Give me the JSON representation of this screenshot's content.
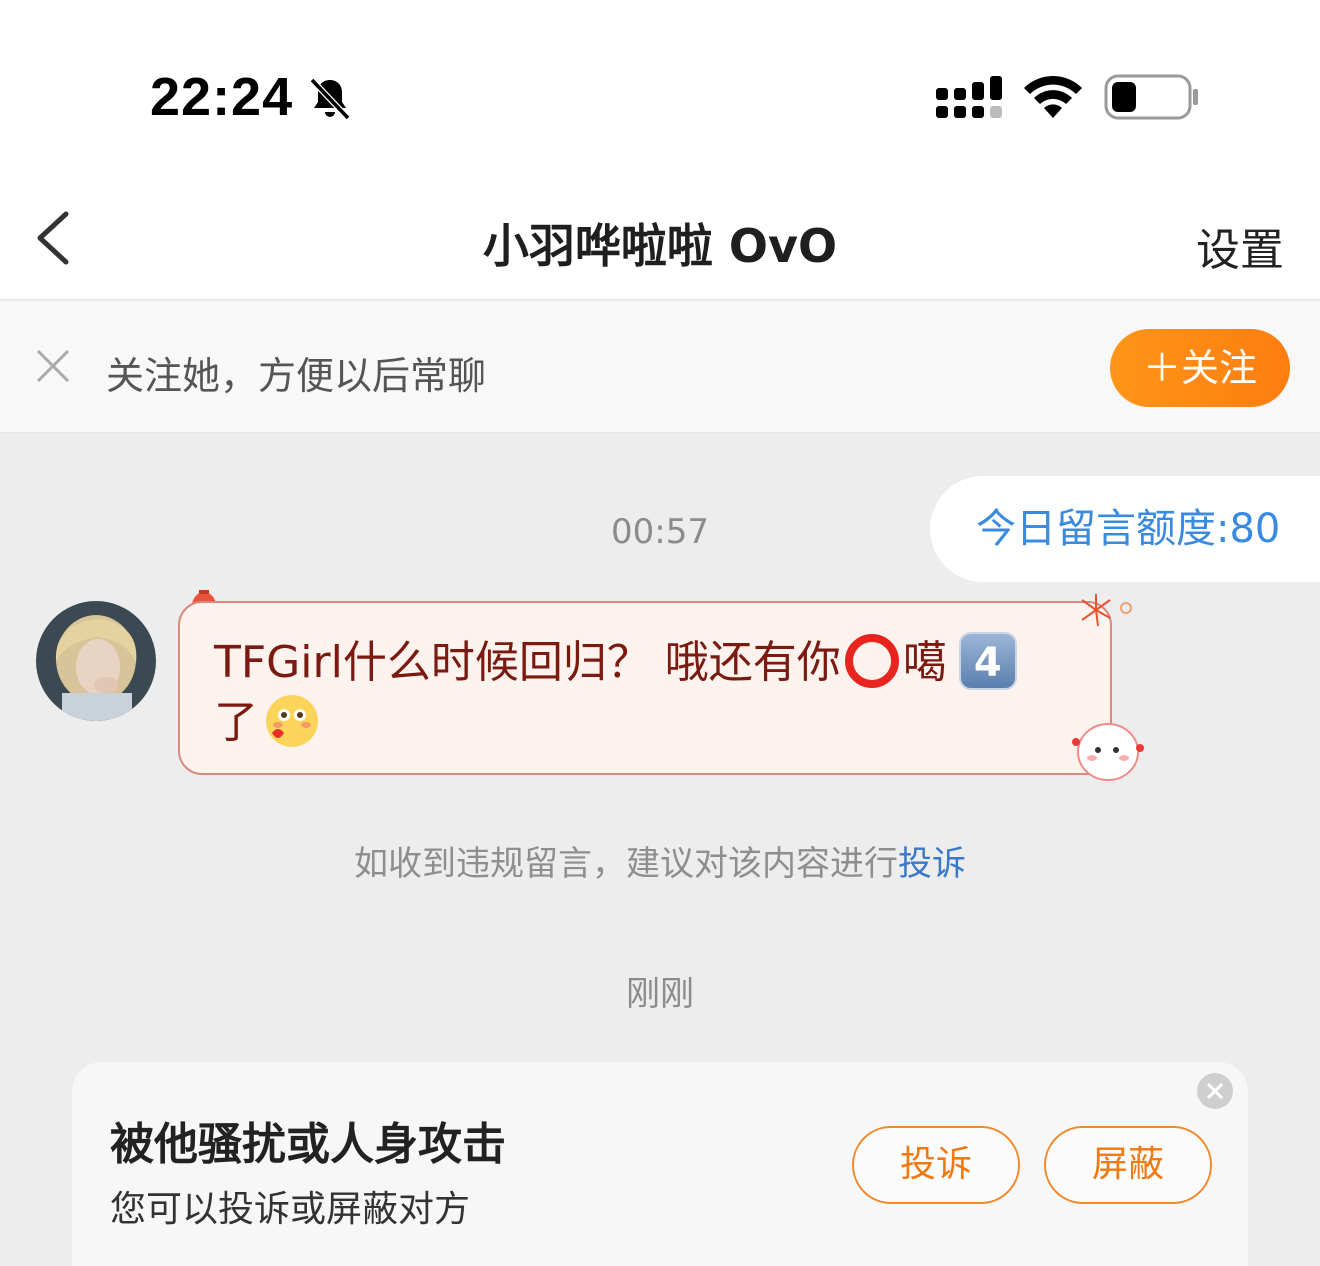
{
  "status_bar": {
    "time": "22:24",
    "icons": [
      "bell-off-icon",
      "cellular-signal-icon",
      "wifi-icon",
      "battery-icon"
    ]
  },
  "nav": {
    "title": "小羽哗啦啦 OvO",
    "settings_label": "设置"
  },
  "follow_banner": {
    "text": "关注她，方便以后常聊",
    "button_label": "＋关注"
  },
  "chat": {
    "quota": "今日留言额度:80",
    "messages": [
      {
        "time": "00:57",
        "text_part1": "TFGirl什么时候回归？ 哦还有你",
        "text_part2": "噶",
        "text_keycap": "4",
        "text_part3": "了"
      }
    ],
    "report_hint": "如收到违规留言，建议对该内容进行",
    "report_link": "投诉",
    "time_2": "刚刚"
  },
  "harassment_card": {
    "title": "被他骚扰或人身攻击",
    "subtitle": "您可以投诉或屏蔽对方",
    "report_label": "投诉",
    "block_label": "屏蔽"
  },
  "colors": {
    "accent_orange": "#fe8a15",
    "link_blue": "#3a78c8",
    "bubble_border": "#d9897e",
    "bubble_text": "#7a1a10"
  }
}
